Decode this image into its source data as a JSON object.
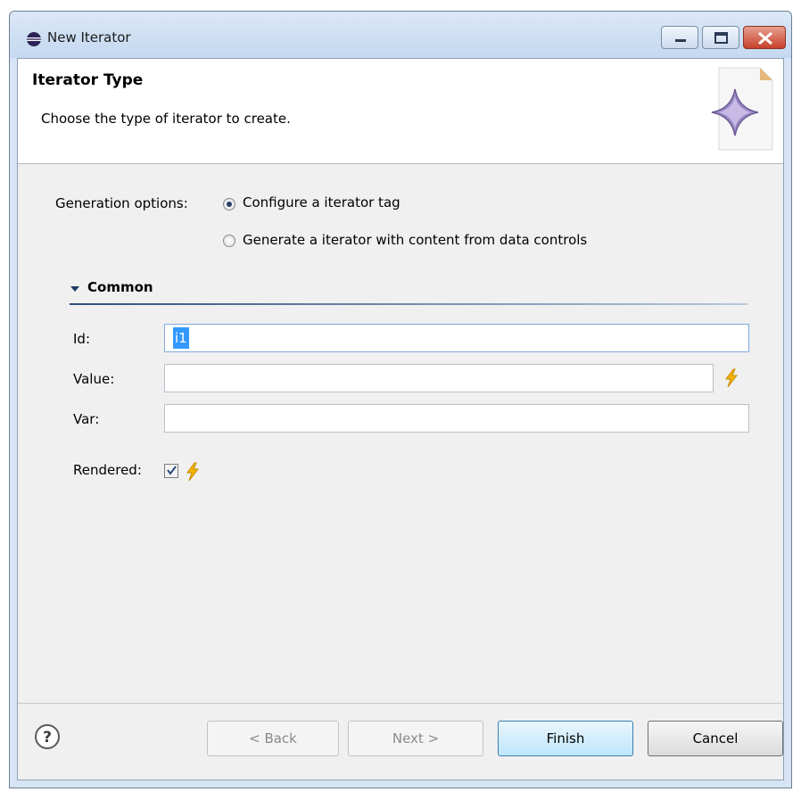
{
  "window": {
    "title": "New Iterator",
    "icon": "eclipse-icon"
  },
  "header": {
    "title": "Iterator Type",
    "description": "Choose the type of iterator to create."
  },
  "generation": {
    "label": "Generation options:",
    "options": [
      {
        "label": "Configure a iterator tag",
        "selected": true
      },
      {
        "label": "Generate a iterator with content from data controls",
        "selected": false
      }
    ]
  },
  "section": {
    "title": "Common"
  },
  "fields": {
    "id": {
      "label": "Id:",
      "value": "i1"
    },
    "value": {
      "label": "Value:",
      "value": ""
    },
    "var": {
      "label": "Var:",
      "value": ""
    },
    "rendered": {
      "label": "Rendered:",
      "checked": true
    }
  },
  "buttons": {
    "back": "< Back",
    "next": "Next >",
    "finish": "Finish",
    "cancel": "Cancel"
  },
  "colors": {
    "accent": "#3399ff",
    "bolt": "#f4b400"
  }
}
